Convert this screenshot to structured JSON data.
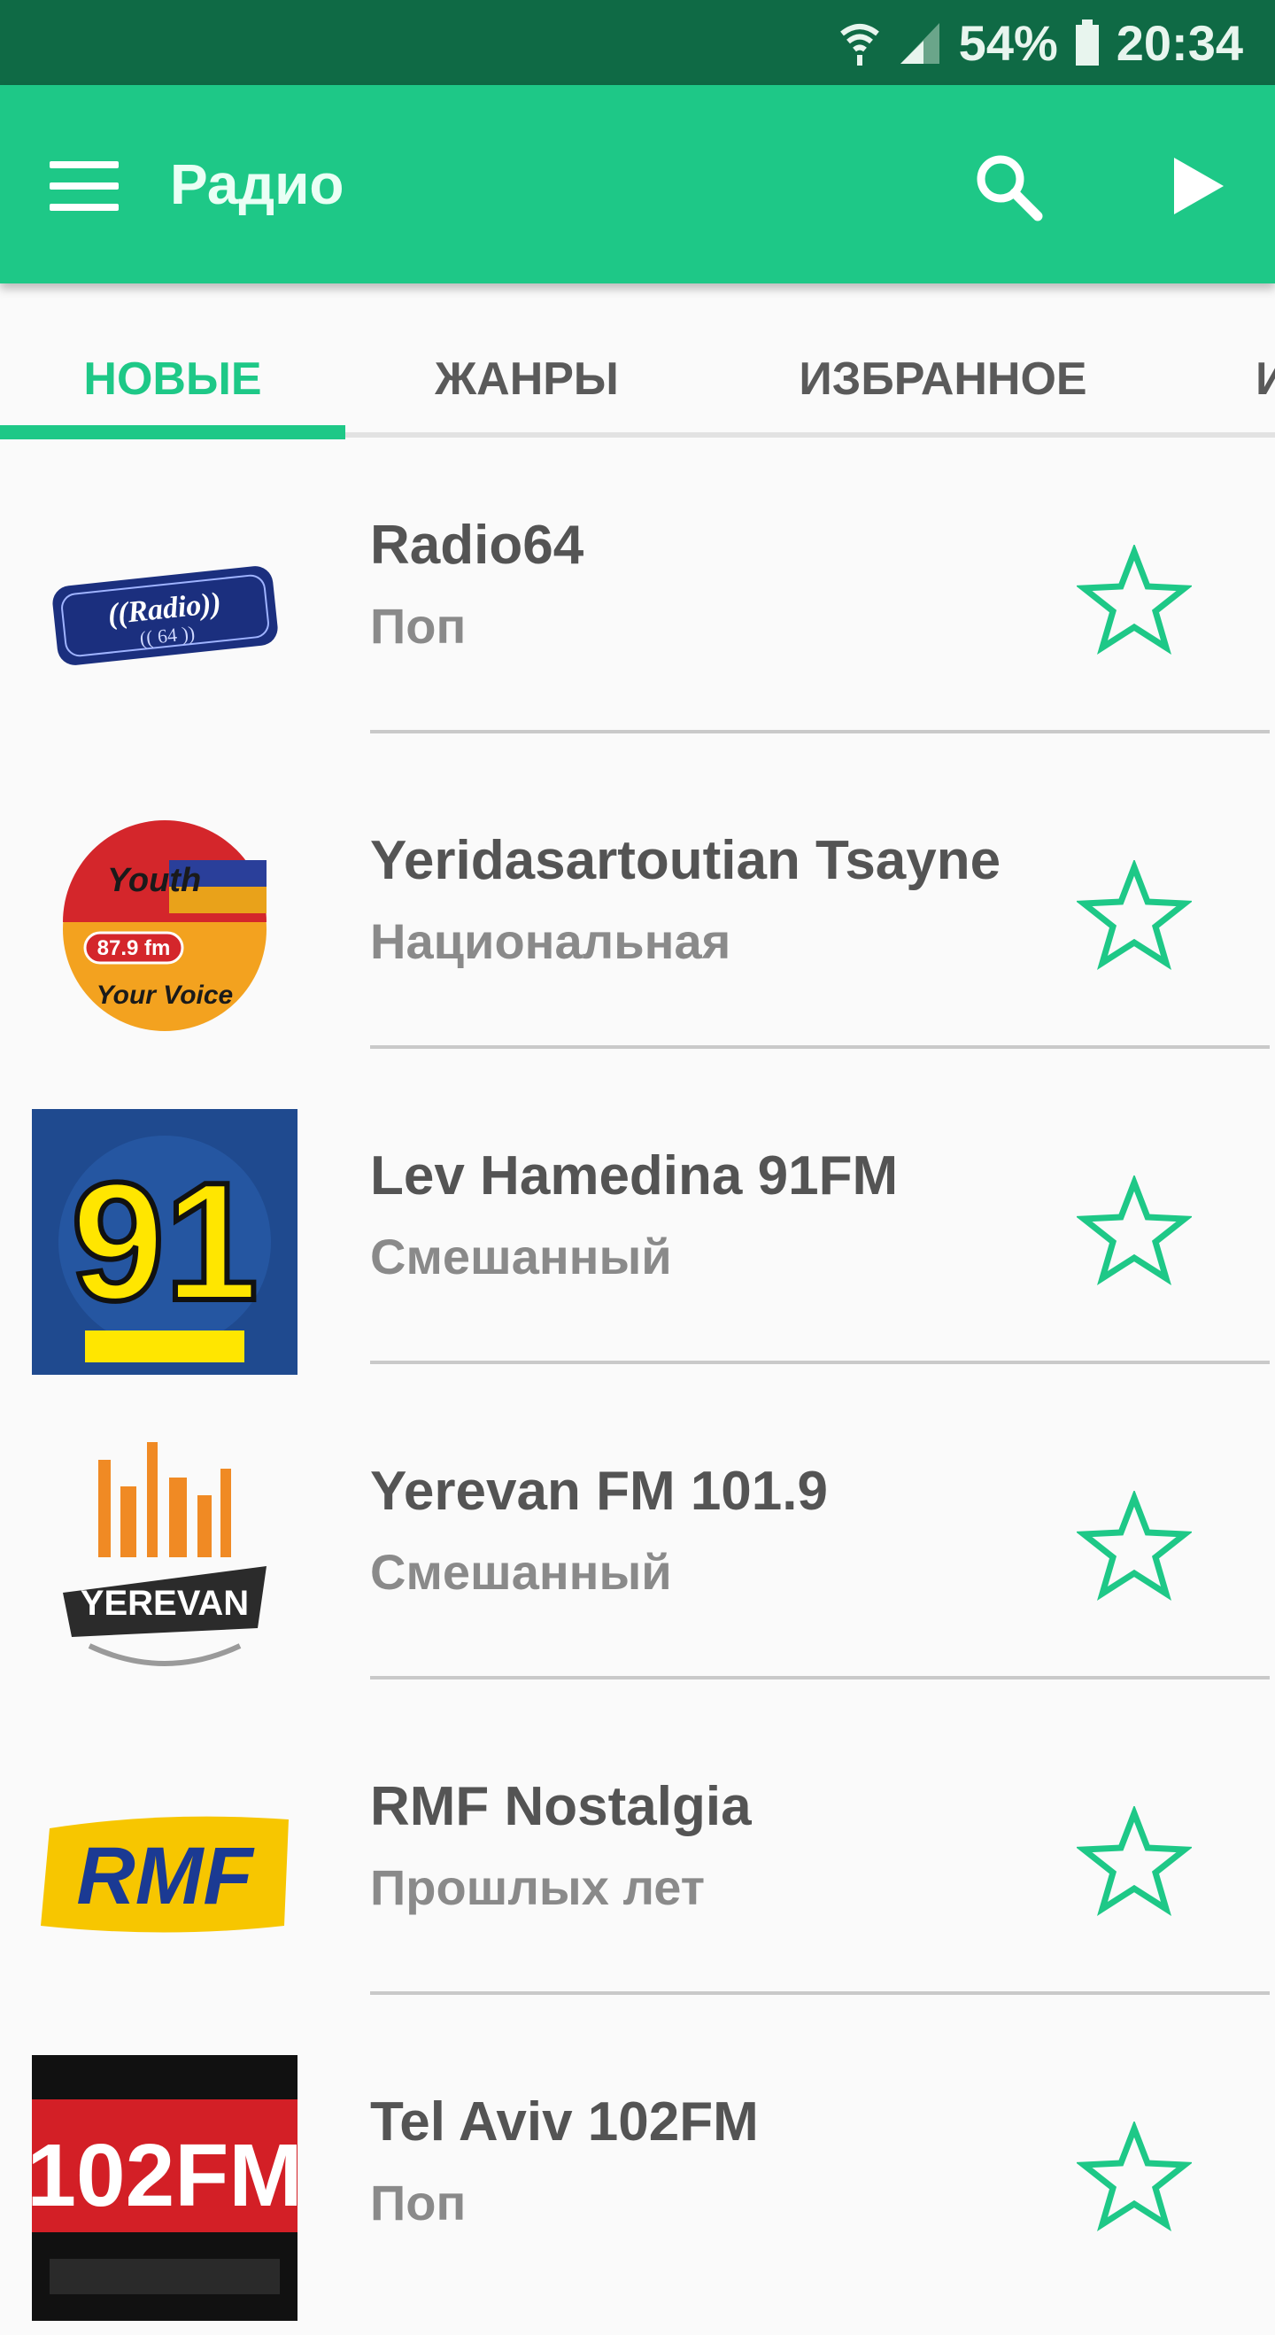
{
  "status_bar": {
    "battery": "54%",
    "time": "20:34"
  },
  "app_bar": {
    "title": "Радио",
    "menu_icon": "hamburger-menu-icon",
    "search_icon": "search-icon",
    "play_icon": "play-icon"
  },
  "tabs": [
    {
      "label": "НОВЫЕ",
      "active": true
    },
    {
      "label": "ЖАНРЫ",
      "active": false
    },
    {
      "label": "ИЗБРАННОЕ",
      "active": false
    },
    {
      "label": "И",
      "active": false
    }
  ],
  "stations": [
    {
      "name": "Radio64",
      "genre": "Поп",
      "logo_text": "((Radio))"
    },
    {
      "name": "Yeridasartoutian Tsayne",
      "genre": "Национальная",
      "logo_text": "Your Voice"
    },
    {
      "name": "Lev Hamedina 91FM",
      "genre": "Смешанный",
      "logo_text": "91"
    },
    {
      "name": "Yerevan FM 101.9",
      "genre": "Смешанный",
      "logo_text": "YEREVAN"
    },
    {
      "name": "RMF Nostalgia",
      "genre": "Прошлых лет",
      "logo_text": "RMF"
    },
    {
      "name": "Tel Aviv 102FM",
      "genre": "Поп",
      "logo_text": "102FM"
    }
  ],
  "colors": {
    "accent": "#1ec887",
    "status_bar": "#0f6a45",
    "text_primary": "#545454",
    "text_secondary": "#8a8a8a"
  }
}
